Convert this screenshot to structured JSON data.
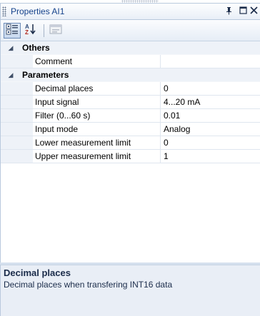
{
  "window": {
    "title": "Properties AI1"
  },
  "toolbar": {
    "buttons": [
      {
        "name": "categorized-button",
        "active": true
      },
      {
        "name": "alphabetical-button",
        "active": false
      },
      {
        "name": "property-pages-button",
        "active": false
      }
    ]
  },
  "grid": {
    "categories": [
      {
        "label": "Others",
        "expanded": true,
        "properties": [
          {
            "name": "Comment",
            "value": ""
          }
        ]
      },
      {
        "label": "Parameters",
        "expanded": true,
        "properties": [
          {
            "name": "Decimal places",
            "value": "0"
          },
          {
            "name": "Input signal",
            "value": "4...20 mA"
          },
          {
            "name": "Filter (0...60 s)",
            "value": "0.01"
          },
          {
            "name": "Input mode",
            "value": "Analog"
          },
          {
            "name": "Lower measurement limit",
            "value": "0"
          },
          {
            "name": "Upper measurement limit",
            "value": "1"
          }
        ]
      }
    ]
  },
  "help": {
    "title": "Decimal places",
    "description": "Decimal places when transfering INT16 data"
  },
  "colors": {
    "title_text": "#15428b",
    "margin": "#eef2f8",
    "help_bg": "#e9eef6"
  }
}
